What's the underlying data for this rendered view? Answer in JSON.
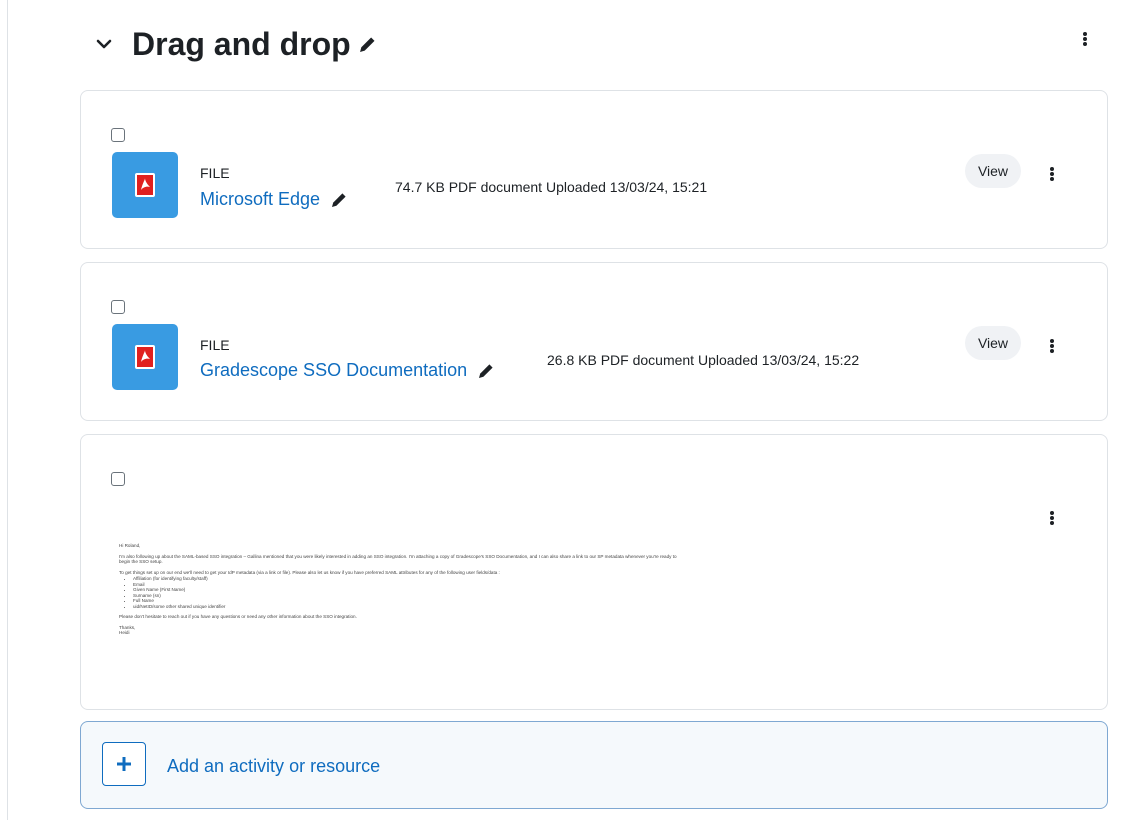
{
  "section": {
    "title": "Drag and drop"
  },
  "items": [
    {
      "type": "FILE",
      "name": "Microsoft Edge",
      "meta": "74.7 KB PDF document Uploaded 13/03/24, 15:21",
      "view_label": "View"
    },
    {
      "type": "FILE",
      "name": "Gradescope SSO Documentation",
      "meta": "26.8 KB PDF document Uploaded 13/03/24, 15:22",
      "view_label": "View"
    }
  ],
  "email": {
    "greeting": "Hi Roland,",
    "para1": "I'm also following up about the SAML-based SSO integration – Gallina mentioned that you were likely interested in adding an SSO integration. I'm attaching a copy of Gradescope's SSO Documentation, and I can also share a link to our SP metadata whenever you're ready to begin the SSO setup.",
    "para2": "To get things set up on our end we'll need to get your IdP metadata (via a link or file). Please also let us know if you have preferred SAML attributes for any of the following user fields/data :",
    "attributes": [
      "Affiliation (for identifying faculty/staff)",
      "Email",
      "Given Name (First Name)",
      "Surname (sn)",
      "Full Name",
      "uid/NetID/some other shared unique identifier"
    ],
    "para3": "Please don't hesitate to reach out if you have any questions or need any other information about the SSO integration.",
    "closing": "Thanks,",
    "signature": "Heidi"
  },
  "add_activity": {
    "label": "Add an activity or resource"
  },
  "icons": {
    "collapse": "chevron-down-icon",
    "edit": "pencil-icon",
    "menu": "kebab-menu-icon",
    "pdf": "pdf-file-icon",
    "add": "plus-icon"
  },
  "colors": {
    "link": "#0f6cbf",
    "file_icon_bg": "#399be2",
    "pdf_red": "#e0201f",
    "card_border": "#dee2e6",
    "add_bg": "#f5f9fc"
  }
}
